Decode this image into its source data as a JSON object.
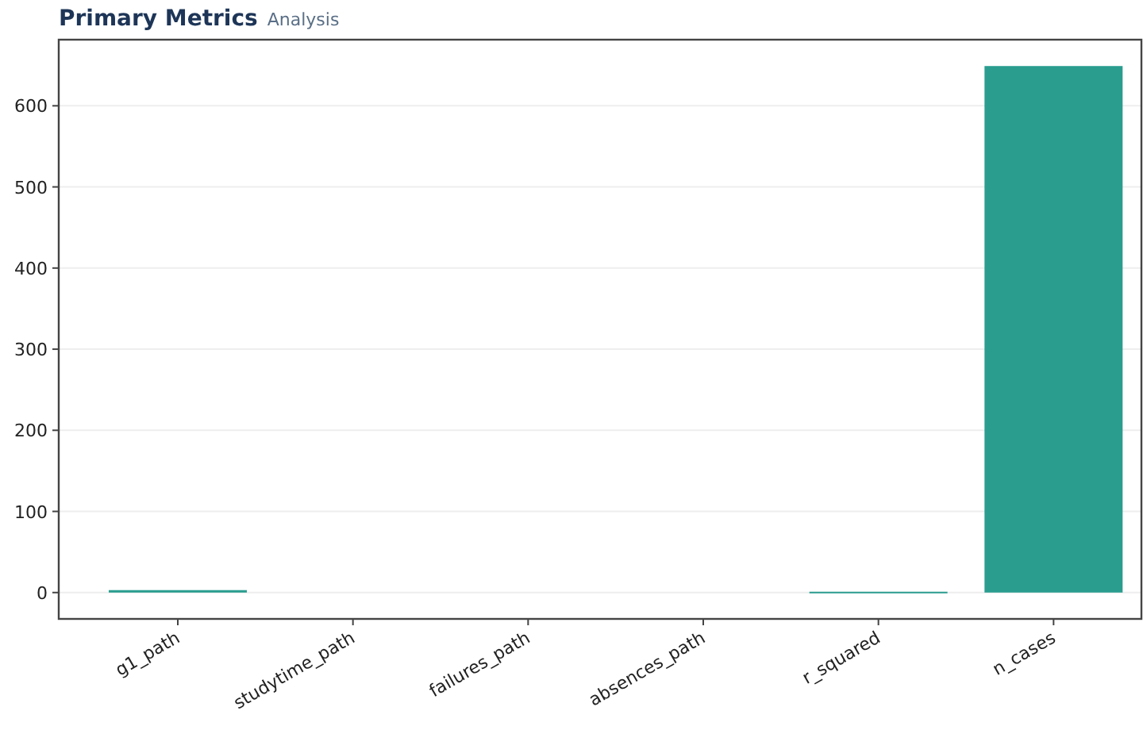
{
  "title": "Primary Metrics",
  "subtitle": "Analysis",
  "chart_data": {
    "type": "bar",
    "categories": [
      "g1_path",
      "studytime_path",
      "failures_path",
      "absences_path",
      "r_squared",
      "n_cases"
    ],
    "series": [
      {
        "color": "#2a9d8f",
        "values": [
          3,
          0,
          0,
          0,
          1,
          649
        ]
      }
    ],
    "ylim": [
      -32.5,
      681.5
    ],
    "yticks": [
      0,
      100,
      200,
      300,
      400,
      500,
      600
    ],
    "grid": true
  }
}
